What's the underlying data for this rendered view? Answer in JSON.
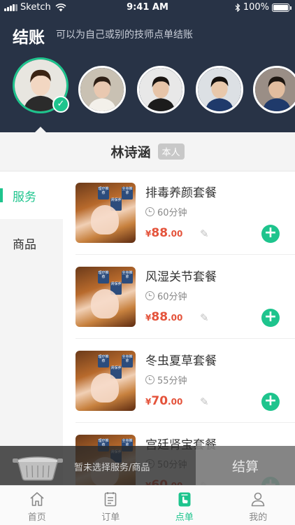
{
  "status_bar": {
    "carrier": "Sketch",
    "time": "9:41 AM",
    "battery": "100%"
  },
  "header": {
    "title": "结账",
    "subtitle": "可以为自己或别的技师点单结账"
  },
  "technicians": [
    {
      "selected": true,
      "hair": "#3a2414",
      "skin": "#f2d7c2",
      "bg": "#e8e6e0"
    },
    {
      "selected": false,
      "hair": "#2e1f15",
      "skin": "#e9c8b0",
      "bg": "#c9c1b3"
    },
    {
      "selected": false,
      "hair": "#1a1512",
      "skin": "#e6c4a8",
      "bg": "#e8e8e8"
    },
    {
      "selected": false,
      "hair": "#15110e",
      "skin": "#e8c8ab",
      "bg": "#dce0e4"
    },
    {
      "selected": false,
      "hair": "#1d1611",
      "skin": "#e2bd9f",
      "bg": "#9a8e86"
    }
  ],
  "current_technician": {
    "name": "林诗涵",
    "badge": "本人"
  },
  "categories": [
    {
      "label": "服务",
      "active": true
    },
    {
      "label": "商品",
      "active": false
    }
  ],
  "services": [
    {
      "name": "排毒养颜套餐",
      "duration": "60分钟",
      "price_symbol": "¥",
      "price_int": "88",
      "price_dec": ".00",
      "tags": [
        "理疗推荐",
        "肾保养",
        "全身推拿"
      ]
    },
    {
      "name": "风湿关节套餐",
      "duration": "60分钟",
      "price_symbol": "¥",
      "price_int": "88",
      "price_dec": ".00",
      "tags": [
        "理疗推荐",
        "肾保养",
        "全身推拿"
      ]
    },
    {
      "name": "冬虫夏草套餐",
      "duration": "55分钟",
      "price_symbol": "¥",
      "price_int": "70",
      "price_dec": ".00",
      "tags": [
        "理疗推荐",
        "肾保养",
        "全身推拿"
      ]
    },
    {
      "name": "宫廷肾宝套餐",
      "duration": "50分钟",
      "price_symbol": "¥",
      "price_int": "60",
      "price_dec": ".00",
      "tags": [
        "理疗推荐",
        "肾保养",
        "全身推拿"
      ]
    }
  ],
  "cart": {
    "empty_text": "暂未选择服务/商品",
    "checkout_label": "结算"
  },
  "tabs": [
    {
      "label": "首页",
      "icon": "home-icon",
      "active": false
    },
    {
      "label": "订单",
      "icon": "order-icon",
      "active": false
    },
    {
      "label": "点单",
      "icon": "place-order-icon",
      "active": true
    },
    {
      "label": "我的",
      "icon": "profile-icon",
      "active": false
    }
  ],
  "colors": {
    "accent": "#1ec48d",
    "header_bg": "#283346",
    "price": "#e4533b"
  }
}
